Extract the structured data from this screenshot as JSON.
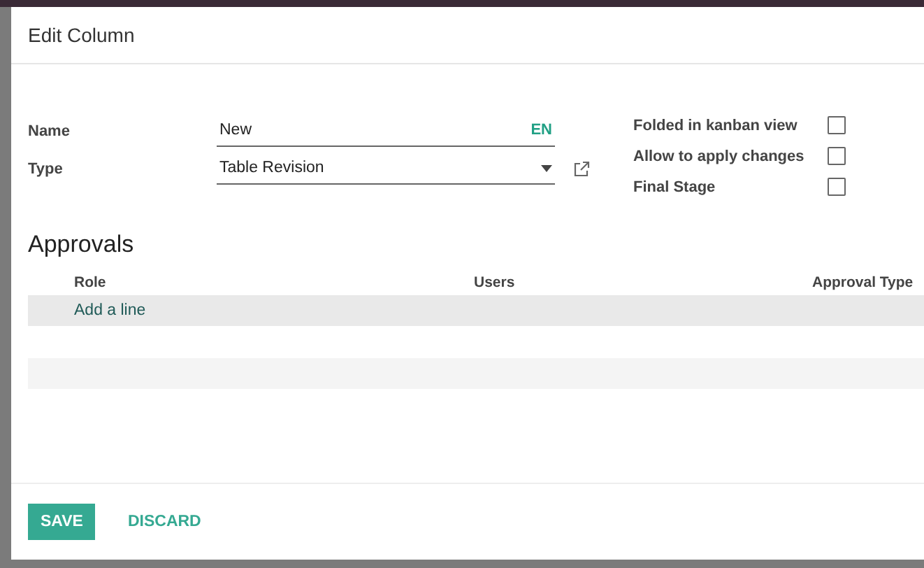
{
  "dialog": {
    "title": "Edit Column"
  },
  "name_field": {
    "label": "Name",
    "value": "New",
    "language": "EN"
  },
  "type_field": {
    "label": "Type",
    "value": "Table Revision"
  },
  "options": [
    {
      "label": "Folded in kanban view",
      "checked": false
    },
    {
      "label": "Allow to apply changes",
      "checked": false
    },
    {
      "label": "Final Stage",
      "checked": false
    }
  ],
  "approvals": {
    "title": "Approvals",
    "columns": [
      "Role",
      "Users",
      "Approval Type"
    ],
    "add_line": "Add a line"
  },
  "buttons": [
    {
      "label": "SAVE",
      "kind": "primary"
    },
    {
      "label": "DISCARD",
      "kind": "link"
    }
  ]
}
